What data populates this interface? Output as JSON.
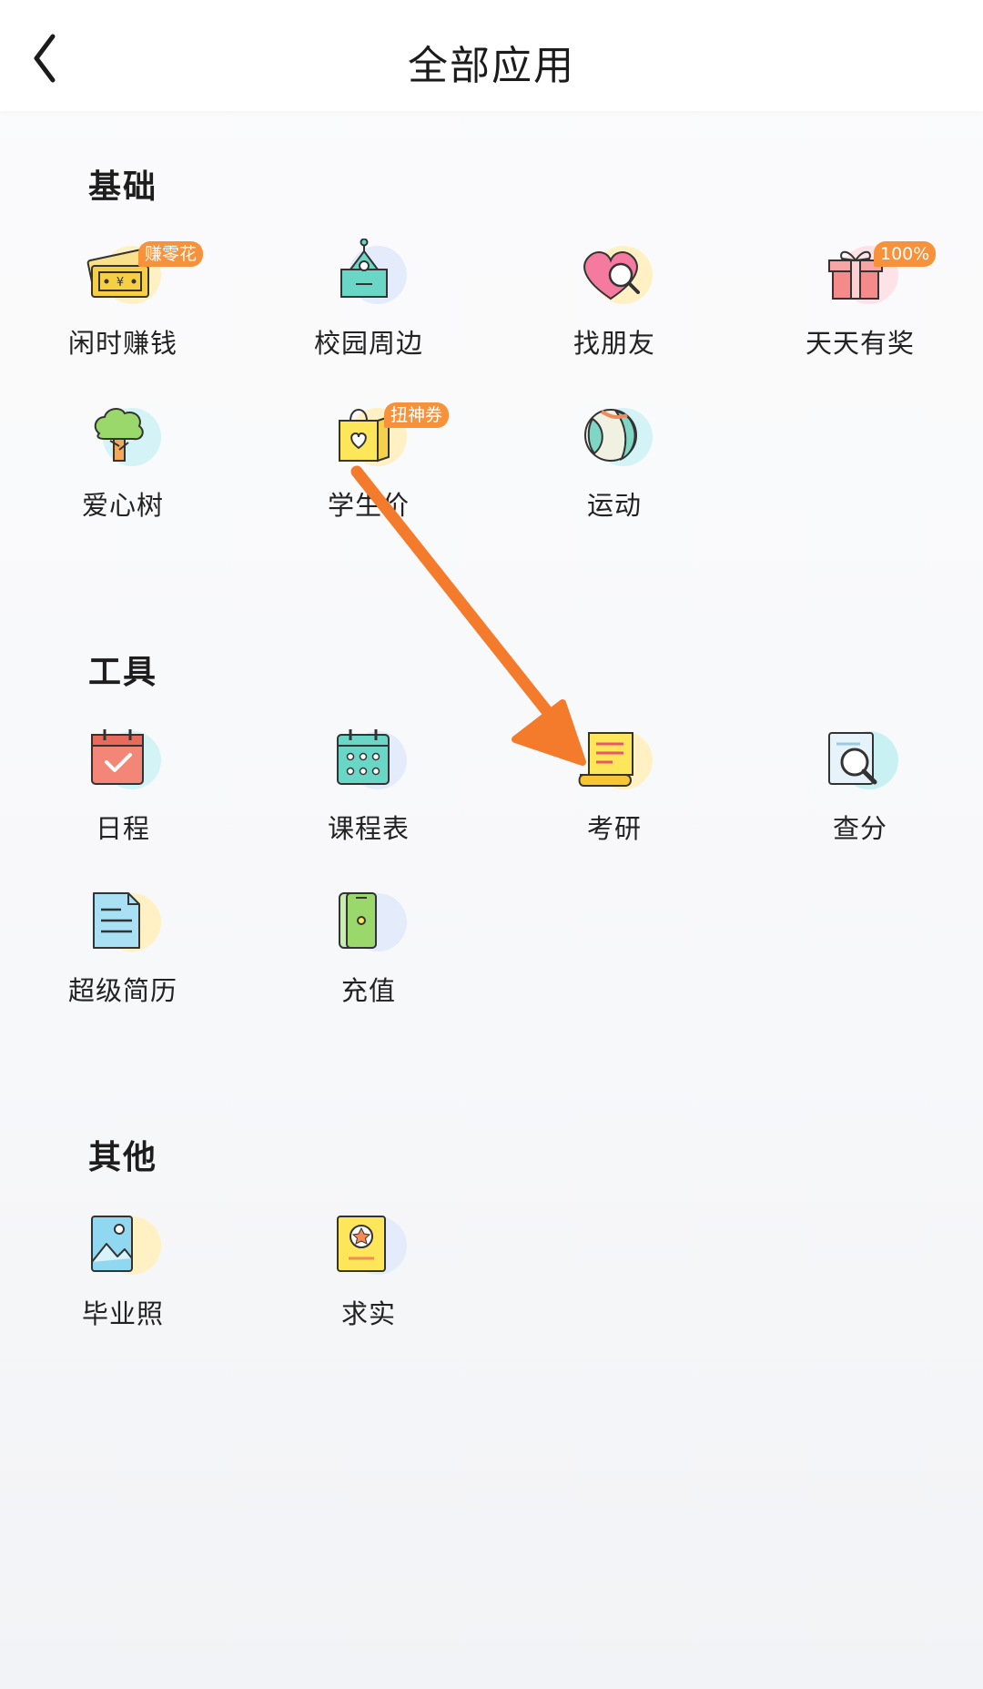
{
  "header": {
    "title": "全部应用"
  },
  "sections": [
    {
      "title": "基础",
      "apps": [
        {
          "label": "闲时赚钱",
          "icon": "money-icon",
          "badge": "赚零花"
        },
        {
          "label": "校园周边",
          "icon": "campus-building-icon"
        },
        {
          "label": "找朋友",
          "icon": "heart-search-icon"
        },
        {
          "label": "天天有奖",
          "icon": "gift-icon",
          "badge": "100%"
        },
        {
          "label": "爱心树",
          "icon": "tree-icon"
        },
        {
          "label": "学生价",
          "icon": "shopping-bag-icon",
          "badge": "扭神券"
        },
        {
          "label": "运动",
          "icon": "ball-icon"
        }
      ]
    },
    {
      "title": "工具",
      "apps": [
        {
          "label": "日程",
          "icon": "calendar-check-icon"
        },
        {
          "label": "课程表",
          "icon": "timetable-icon"
        },
        {
          "label": "考研",
          "icon": "scroll-icon"
        },
        {
          "label": "查分",
          "icon": "document-search-icon"
        },
        {
          "label": "超级简历",
          "icon": "resume-icon"
        },
        {
          "label": "充值",
          "icon": "phone-recharge-icon"
        }
      ]
    },
    {
      "title": "其他",
      "apps": [
        {
          "label": "毕业照",
          "icon": "photo-icon"
        },
        {
          "label": "求实",
          "icon": "star-book-icon"
        }
      ]
    }
  ],
  "colors": {
    "badge": "#f7913a",
    "arrow": "#f47a2c"
  }
}
